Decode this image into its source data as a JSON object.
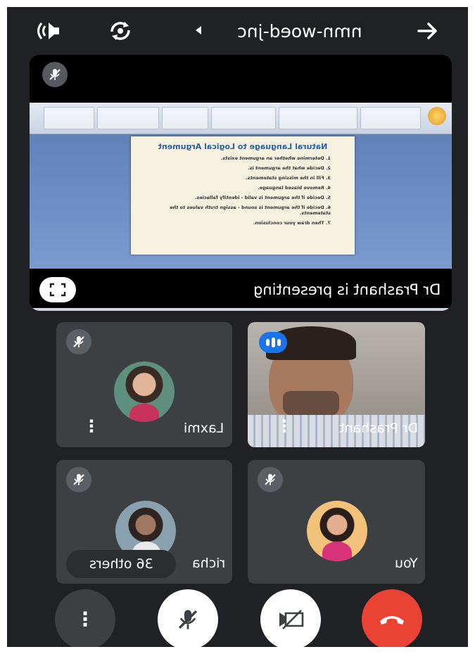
{
  "header": {
    "meeting_code": "nmn-woed-jnc",
    "icons": [
      "back-arrow-icon",
      "dropdown-caret-icon",
      "switch-camera-icon",
      "speaker-icon"
    ]
  },
  "presentation": {
    "label": "Dr Prashant is presenting",
    "slide": {
      "title": "Natural Language to Logical Argument",
      "lines": [
        "1. Determine whether an argument exists.",
        "2. Decide what the argument is.",
        "3. Fill in the missing statements.",
        "4. Remove biased language.",
        "5. Decide if the argument is valid - identify fallacies.",
        "6. Decide if the argument is sound - assign truth values to the statements.",
        "7. Then draw your conclusion."
      ]
    }
  },
  "participants": [
    {
      "name": "Laxmi",
      "muted": true
    },
    {
      "name": "Dr Prashant",
      "muted": false,
      "speaking": true
    },
    {
      "name": "richa",
      "muted": true
    },
    {
      "name": "You",
      "muted": true
    }
  ],
  "others_label": "36 others",
  "controls": {
    "icons": [
      "more-options-icon",
      "mic-off-icon",
      "camera-off-icon",
      "end-call-icon"
    ],
    "end_call_color": "#ea4335"
  }
}
